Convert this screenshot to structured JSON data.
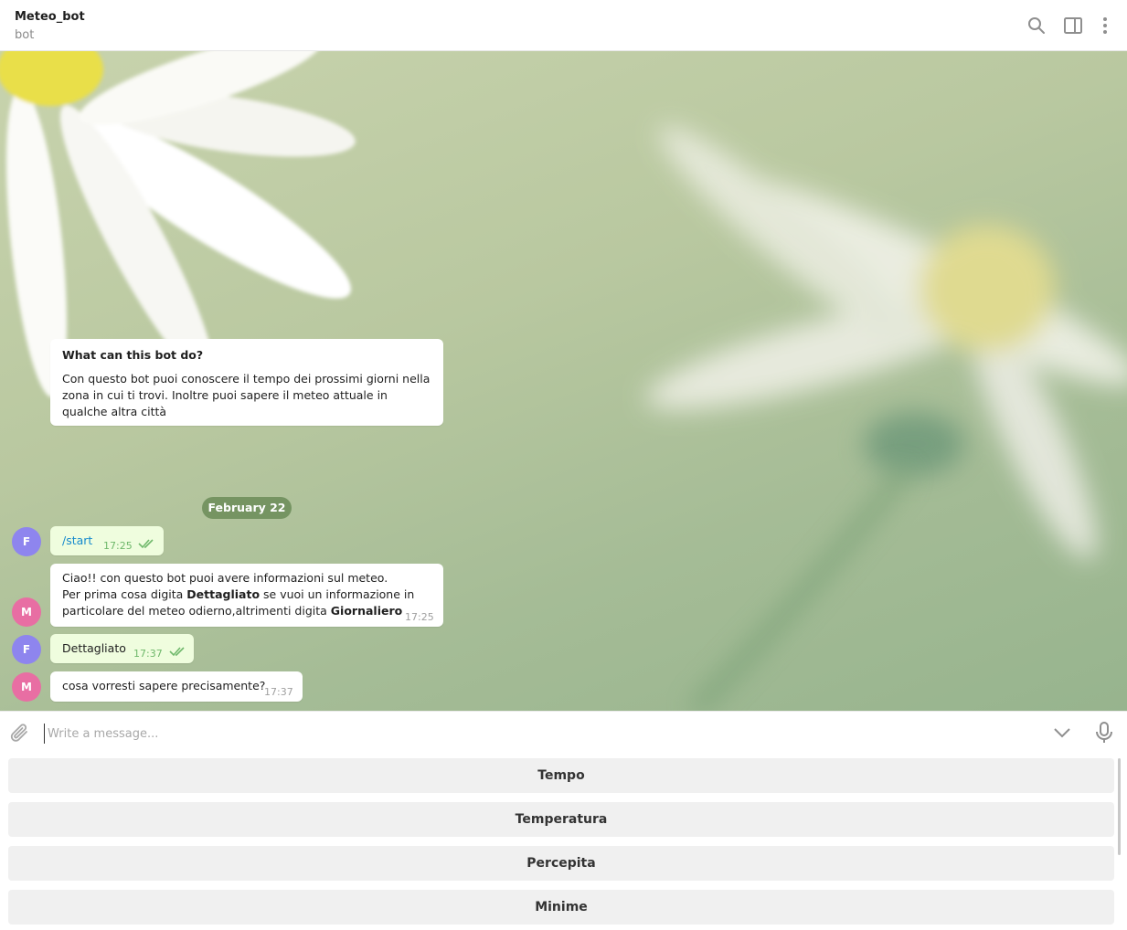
{
  "header": {
    "title": "Meteo_bot",
    "subtitle": "bot",
    "icons": [
      "search-icon",
      "sidebar-toggle-icon",
      "more-vertical-icon"
    ]
  },
  "info_card": {
    "heading": "What can this bot do?",
    "body": "Con questo bot puoi conoscere il tempo dei prossimi giorni nella zona in cui ti trovi. Inoltre puoi sapere il meteo attuale in qualche altra città"
  },
  "date_separator": "February 22",
  "messages": [
    {
      "sender_initial": "F",
      "direction": "outgoing",
      "text": "/start",
      "time": "17:25",
      "status": "read"
    },
    {
      "sender_initial": "M",
      "direction": "incoming",
      "line1": "Ciao!! con questo bot puoi avere informazioni sul meteo.",
      "line2_pre": "Per prima cosa digita ",
      "line2_bold": "Dettagliato",
      "line2_post": " se vuoi un informazione in",
      "line3_pre": "particolare del meteo odierno,altrimenti digita ",
      "line3_bold": "Giornaliero",
      "time": "17:25"
    },
    {
      "sender_initial": "F",
      "direction": "outgoing",
      "text": "Dettagliato",
      "time": "17:37",
      "status": "read"
    },
    {
      "sender_initial": "M",
      "direction": "incoming",
      "text": "cosa vorresti sapere precisamente?",
      "time": "17:37"
    }
  ],
  "composer": {
    "placeholder": "Write a message...",
    "value": ""
  },
  "keyboard": {
    "buttons": [
      "Tempo",
      "Temperatura",
      "Percepita",
      "Minime"
    ]
  },
  "colors": {
    "outgoing_bubble": "#effdde",
    "incoming_bubble": "#ffffff",
    "read_check": "#6fb86b",
    "link": "#168acd",
    "avatar_f": "#8e85ee",
    "avatar_m": "#e86ea3"
  }
}
